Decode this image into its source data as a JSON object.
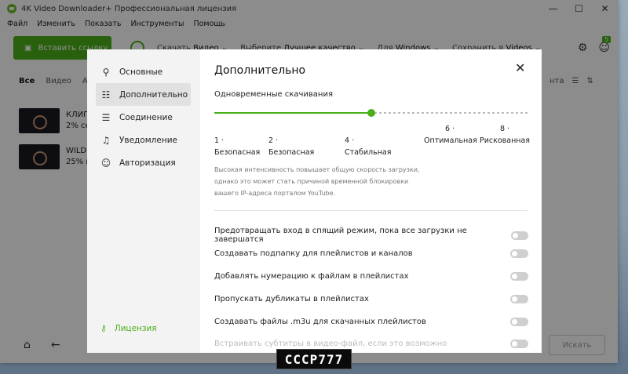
{
  "window": {
    "title": "4K Video Downloader+ Профессиональная лицензия",
    "minimize": "—",
    "maximize": "☐",
    "close": "✕"
  },
  "menu": [
    "Файл",
    "Изменить",
    "Показать",
    "Инструменты",
    "Помощь"
  ],
  "toolbar": {
    "paste": "Вставить ссылку",
    "download_label": "Скачать",
    "download_value": "Видео",
    "quality_label": "Выберите",
    "quality_value": "Лучшее качество",
    "for_label": "Для",
    "for_value": "Windows",
    "save_label": "Сохранить в",
    "save_value": "Videos",
    "badge": "5"
  },
  "filters": {
    "all": "Все",
    "video": "Видео",
    "audio": "Ау",
    "right_text": "нта"
  },
  "downloads": [
    {
      "title": "КЛИП",
      "status": "2% ск"
    },
    {
      "title": "WILD",
      "status": "25% к"
    }
  ],
  "bottom": {
    "search": "Искать"
  },
  "dialog": {
    "nav": [
      {
        "label": "Основные",
        "icon": "wrench-icon"
      },
      {
        "label": "Дополнительно",
        "icon": "sliders-icon"
      },
      {
        "label": "Соединение",
        "icon": "server-icon"
      },
      {
        "label": "Уведомление",
        "icon": "bell-icon"
      },
      {
        "label": "Авторизация",
        "icon": "user-icon"
      }
    ],
    "license": "Лицензия",
    "title": "Дополнительно",
    "concurrent_label": "Одновременные скачивания",
    "slider_value": 4,
    "slider_max": 8,
    "ticks": [
      {
        "line1": "",
        "line2": "1 · Безопасная"
      },
      {
        "line1": "",
        "line2": "2 · Безопасная"
      },
      {
        "line1": "",
        "line2": "4 · Стабильная"
      },
      {
        "line1": "6 ·",
        "line2": "Оптимальная"
      },
      {
        "line1": "8 ·",
        "line2": "Рискованная"
      }
    ],
    "note": "Высокая интенсивность повышает общую скорость загрузки, однако это может стать причиной временной блокировки вашего IP-адреса порталом YouTube.",
    "options": [
      {
        "label": "Предотвращать вход в спящий режим, пока все загрузки не завершатся",
        "on": false
      },
      {
        "label": "Создавать подпапку для плейлистов и каналов",
        "on": false
      },
      {
        "label": "Добавлять нумерацию к файлам в плейлистах",
        "on": false
      },
      {
        "label": "Пропускать дубликаты в плейлистах",
        "on": false
      },
      {
        "label": "Создавать файлы .m3u для скачанных плейлистов",
        "on": false
      },
      {
        "label": "Встраивать субтитры в видео-файл, если это возможно",
        "on": false
      }
    ]
  },
  "watermark": "CCCP777"
}
